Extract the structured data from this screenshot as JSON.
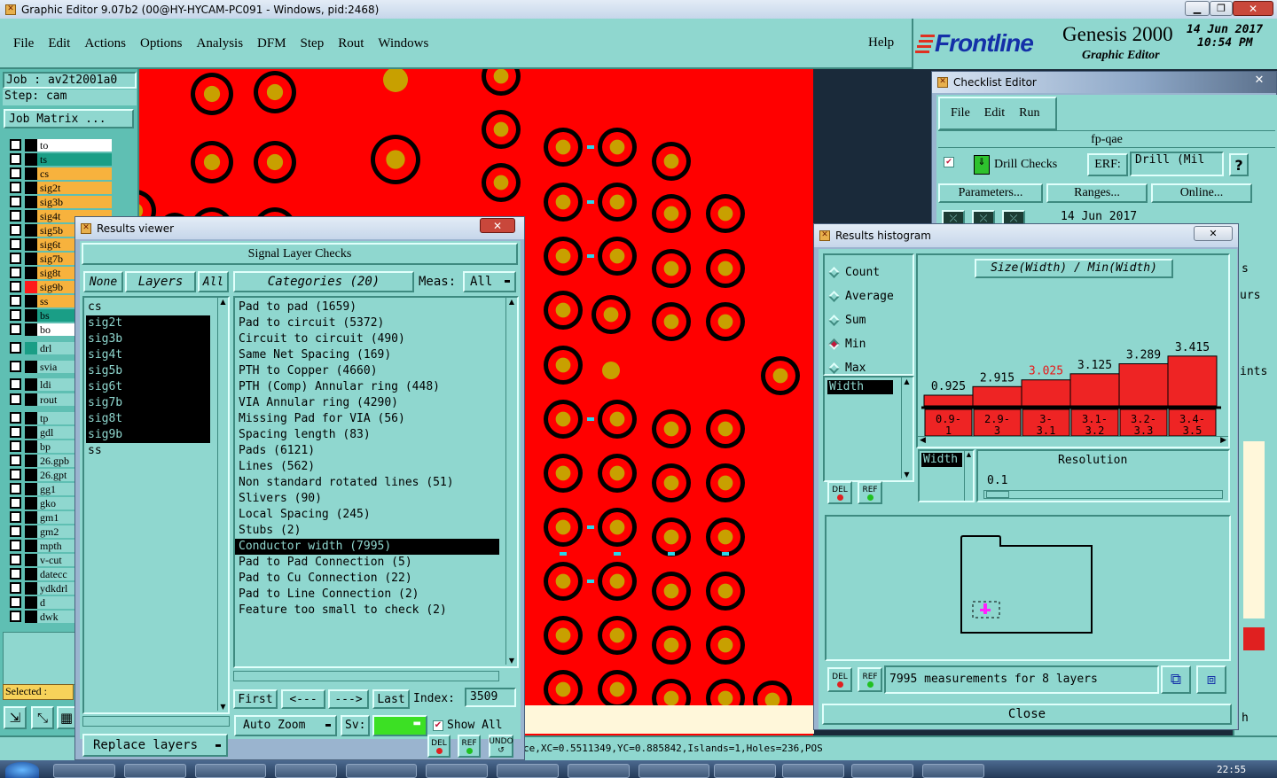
{
  "window": {
    "title": "Graphic Editor 9.07b2 (00@HY-HYCAM-PC091 - Windows, pid:2468)"
  },
  "menu": {
    "items": [
      "File",
      "Edit",
      "Actions",
      "Options",
      "Analysis",
      "DFM",
      "Step",
      "Rout",
      "Windows"
    ],
    "help": "Help"
  },
  "brand": {
    "logo": "Frontline",
    "product": "Genesis 2000",
    "subtitle": "Graphic Editor",
    "date": "14 Jun 2017",
    "time": "10:54 PM"
  },
  "job": {
    "job_label": "Job : av2t2001a0",
    "step_label": "Step: cam",
    "matrix_button": "Job Matrix ..."
  },
  "layers": [
    {
      "name": "to",
      "color": "#ffffff"
    },
    {
      "name": "ts",
      "color": "#1a9e86"
    },
    {
      "name": "cs",
      "color": "#f7b23d"
    },
    {
      "name": "sig2t",
      "color": "#f7b23d"
    },
    {
      "name": "sig3b",
      "color": "#f7b23d"
    },
    {
      "name": "sig4t",
      "color": "#f7b23d"
    },
    {
      "name": "sig5b",
      "color": "#f7b23d"
    },
    {
      "name": "sig6t",
      "color": "#f7b23d"
    },
    {
      "name": "sig7b",
      "color": "#f7b23d"
    },
    {
      "name": "sig8t",
      "color": "#f7b23d"
    },
    {
      "name": "sig9b",
      "color": "#f7b23d"
    },
    {
      "name": "ss",
      "color": "#f7b23d"
    },
    {
      "name": "bs",
      "color": "#1a9e86"
    },
    {
      "name": "bo",
      "color": "#ffffff"
    },
    {
      "name": "drl",
      "color": "#8fd7cf"
    },
    {
      "name": "svia",
      "color": "#8fd7cf"
    },
    {
      "name": "ldi",
      "color": "#8fd7cf"
    },
    {
      "name": "rout",
      "color": "#8fd7cf"
    },
    {
      "name": "tp",
      "color": "#8fd7cf"
    },
    {
      "name": "gdl",
      "color": "#8fd7cf"
    },
    {
      "name": "bp",
      "color": "#8fd7cf"
    },
    {
      "name": "26.gpb",
      "color": "#8fd7cf"
    },
    {
      "name": "26.gpt",
      "color": "#8fd7cf"
    },
    {
      "name": "gg1",
      "color": "#8fd7cf"
    },
    {
      "name": "gko",
      "color": "#8fd7cf"
    },
    {
      "name": "gm1",
      "color": "#8fd7cf"
    },
    {
      "name": "gm2",
      "color": "#8fd7cf"
    },
    {
      "name": "mpth",
      "color": "#8fd7cf"
    },
    {
      "name": "v-cut",
      "color": "#8fd7cf"
    },
    {
      "name": "datecc",
      "color": "#8fd7cf"
    },
    {
      "name": "ydkdrl",
      "color": "#8fd7cf"
    },
    {
      "name": "d",
      "color": "#8fd7cf"
    },
    {
      "name": "dwk",
      "color": "#8fd7cf"
    }
  ],
  "selected_label": "Selected :",
  "results_viewer": {
    "title": "Results viewer",
    "header": "Signal Layer Checks",
    "none_btn": "None",
    "layers_btn": "Layers",
    "all_btn": "All",
    "categories_btn": "Categories (20)",
    "meas_label": "Meas:",
    "meas_value": "All",
    "layer_list": [
      "cs",
      "sig2t",
      "sig3b",
      "sig4t",
      "sig5b",
      "sig6t",
      "sig7b",
      "sig8t",
      "sig9b",
      "ss"
    ],
    "categories": [
      "Pad to pad (1659)",
      "Pad to circuit (5372)",
      "Circuit to circuit (490)",
      "Same Net Spacing (169)",
      "PTH to Copper (4660)",
      "PTH (Comp) Annular ring (448)",
      "VIA Annular ring (4290)",
      "Missing Pad for VIA (56)",
      "Spacing length (83)",
      "Pads (6121)",
      "Lines (562)",
      "Non standard rotated lines (51)",
      "Slivers (90)",
      "Local Spacing (245)",
      "Stubs (2)",
      "Conductor width (7995)",
      "Pad to Pad Connection (5)",
      "Pad to Cu Connection (22)",
      "Pad to Line Connection (2)",
      "Feature too small to check (2)"
    ],
    "first_btn": "First",
    "prev_btn": "<---",
    "next_btn": "--->",
    "last_btn": "Last",
    "index_label": "Index:",
    "index_value": "3509",
    "auto_zoom": "Auto Zoom",
    "sv_label": "Sv:",
    "show_all": "Show All",
    "replace_layers": "Replace layers",
    "del": "DEL",
    "ref": "REF",
    "undo": "UNDO"
  },
  "checklist": {
    "title": "Checklist Editor",
    "menu": [
      "File",
      "Edit",
      "Run"
    ],
    "name": "fp-qae",
    "check_name": "Drill Checks",
    "erf_label": "ERF:",
    "erf_value": "Drill (Mil",
    "parameters": "Parameters...",
    "ranges": "Ranges...",
    "online": "Online...",
    "date": "14 Jun 2017"
  },
  "histogram": {
    "title": "Results histogram",
    "modes": [
      "Count",
      "Average",
      "Sum",
      "Min",
      "Max"
    ],
    "selected_mode": "Min",
    "measure_item": "Width",
    "chart_title": "Size(Width) / Min(Width)",
    "width_label": "Width",
    "resolution_label": "Resolution",
    "resolution_value": "0.1",
    "status": "7995 measurements for 8 layers",
    "close": "Close",
    "del": "DEL",
    "ref": "REF"
  },
  "chart_data": {
    "type": "bar",
    "title": "Size(Width) / Min(Width)",
    "categories": [
      "0.9-1",
      "2.9-3",
      "3-3.1",
      "3.1-3.2",
      "3.2-3.3",
      "3.4-3.5"
    ],
    "values": [
      0.925,
      2.915,
      3.025,
      3.125,
      3.289,
      3.415
    ],
    "value_labels": [
      "0.925",
      "2.915",
      "3.025",
      "3.125",
      "3.289",
      "3.415"
    ],
    "highlight_index": 2,
    "bar_color": "#ee2424",
    "highlight_color": "#e81818"
  },
  "status_bar": {
    "text": "ce,XC=0.5511349,YC=0.885842,Islands=1,Holes=236,POS"
  },
  "right_edge": {
    "s": "s",
    "urs": "urs",
    "ints": "ints",
    "h": "h"
  },
  "taskbar": {
    "clock": "22:55"
  }
}
